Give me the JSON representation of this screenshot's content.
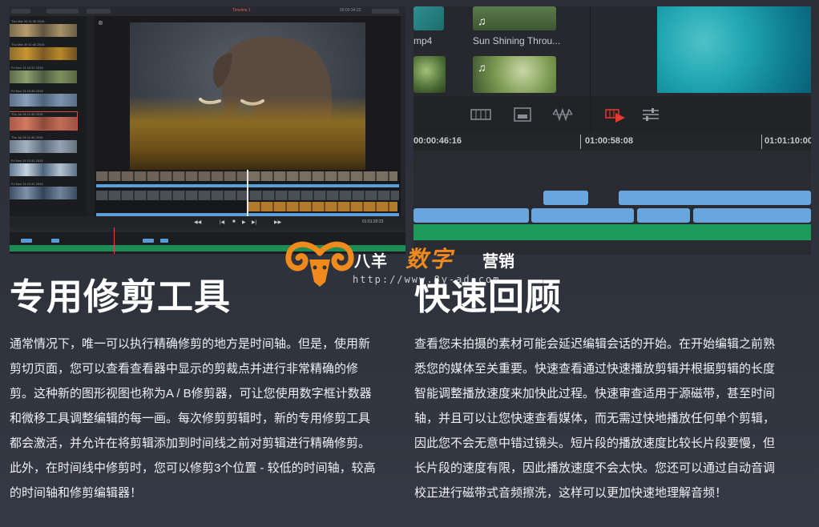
{
  "left_section": {
    "title": "专用修剪工具",
    "lines": [
      "通常情况下，唯一可以执行精确修剪的地方是时间轴。但是，使用新",
      "剪切页面，您可以查看查看器中显示的剪裁点并进行非常精确的修",
      "剪。这种新的图形视图也称为A / B修剪器，可让您使用数字框计数器",
      "和微移工具调整编辑的每一画。每次修剪剪辑时，新的专用修剪工具",
      "都会激活，并允许在将剪辑添加到时间线之前对剪辑进行精确修剪。",
      "此外，在时间线中修剪时，您可以修剪3个位置 - 较低的时间轴，较高",
      "的时间轴和修剪编辑器！"
    ],
    "screenshot": {
      "timeline_name": "Timeline 1",
      "viewer_timecode": "00:00:34:22",
      "transport_timecode": "01:01:20:23",
      "clips": [
        {
          "caption": "Thu Mar 26 11:39 2015"
        },
        {
          "caption": "Thu Mar 26 11:40 2015"
        },
        {
          "caption": "Fri Nov 13 10:37 2015"
        },
        {
          "caption": "Fri Nov 13 10:36 2015"
        },
        {
          "caption": "Thu Jul 28 11:40 2015"
        },
        {
          "caption": "Thu Jul 28 11:40 2015"
        },
        {
          "caption": "Fri Nov 13 10:31 2015"
        },
        {
          "caption": "Fri Nov 13 10:31 2015"
        }
      ]
    }
  },
  "right_section": {
    "title": "快速回顾",
    "lines": [
      "查看您未拍摄的素材可能会延迟编辑会话的开始。在开始编辑之前熟",
      "悉您的媒体至关重要。快速查看通过快速播放剪辑并根据剪辑的长度",
      "智能调整播放速度来加快此过程。快速审查适用于源磁带，甚至时间",
      "轴，并且可以让您快速查看媒体，而无需过快地播放任何单个剪辑，",
      "因此您不会无意中错过镜头。短片段的播放速度比较长片段要慢，但",
      "长片段的速度有限，因此播放速度不会太快。您还可以通过自动音调",
      "校正进行磁带式音频擦洗，这样可以更加快速地理解音频！"
    ],
    "screenshot": {
      "clip_labels": [
        "mp4",
        "Sun Shining Throu..."
      ],
      "ruler_ticks": [
        "00:00:46:16",
        "01:00:58:08",
        "01:01:10:00"
      ],
      "toolbar_icons": [
        "strip-view-icon",
        "source-tape-icon",
        "waveform-icon",
        "fast-review-icon",
        "trim-adjust-icon"
      ],
      "accent_color": "#e8392e"
    }
  },
  "watermark": {
    "brand_a": "八羊",
    "brand_b": "数字",
    "brand_c": "营销",
    "url": "http://www.8y-ad.com"
  },
  "colors": {
    "clip_blue": "#6aa6de",
    "audio_green": "#1e9a5b",
    "brand_orange": "#f08a1c"
  }
}
